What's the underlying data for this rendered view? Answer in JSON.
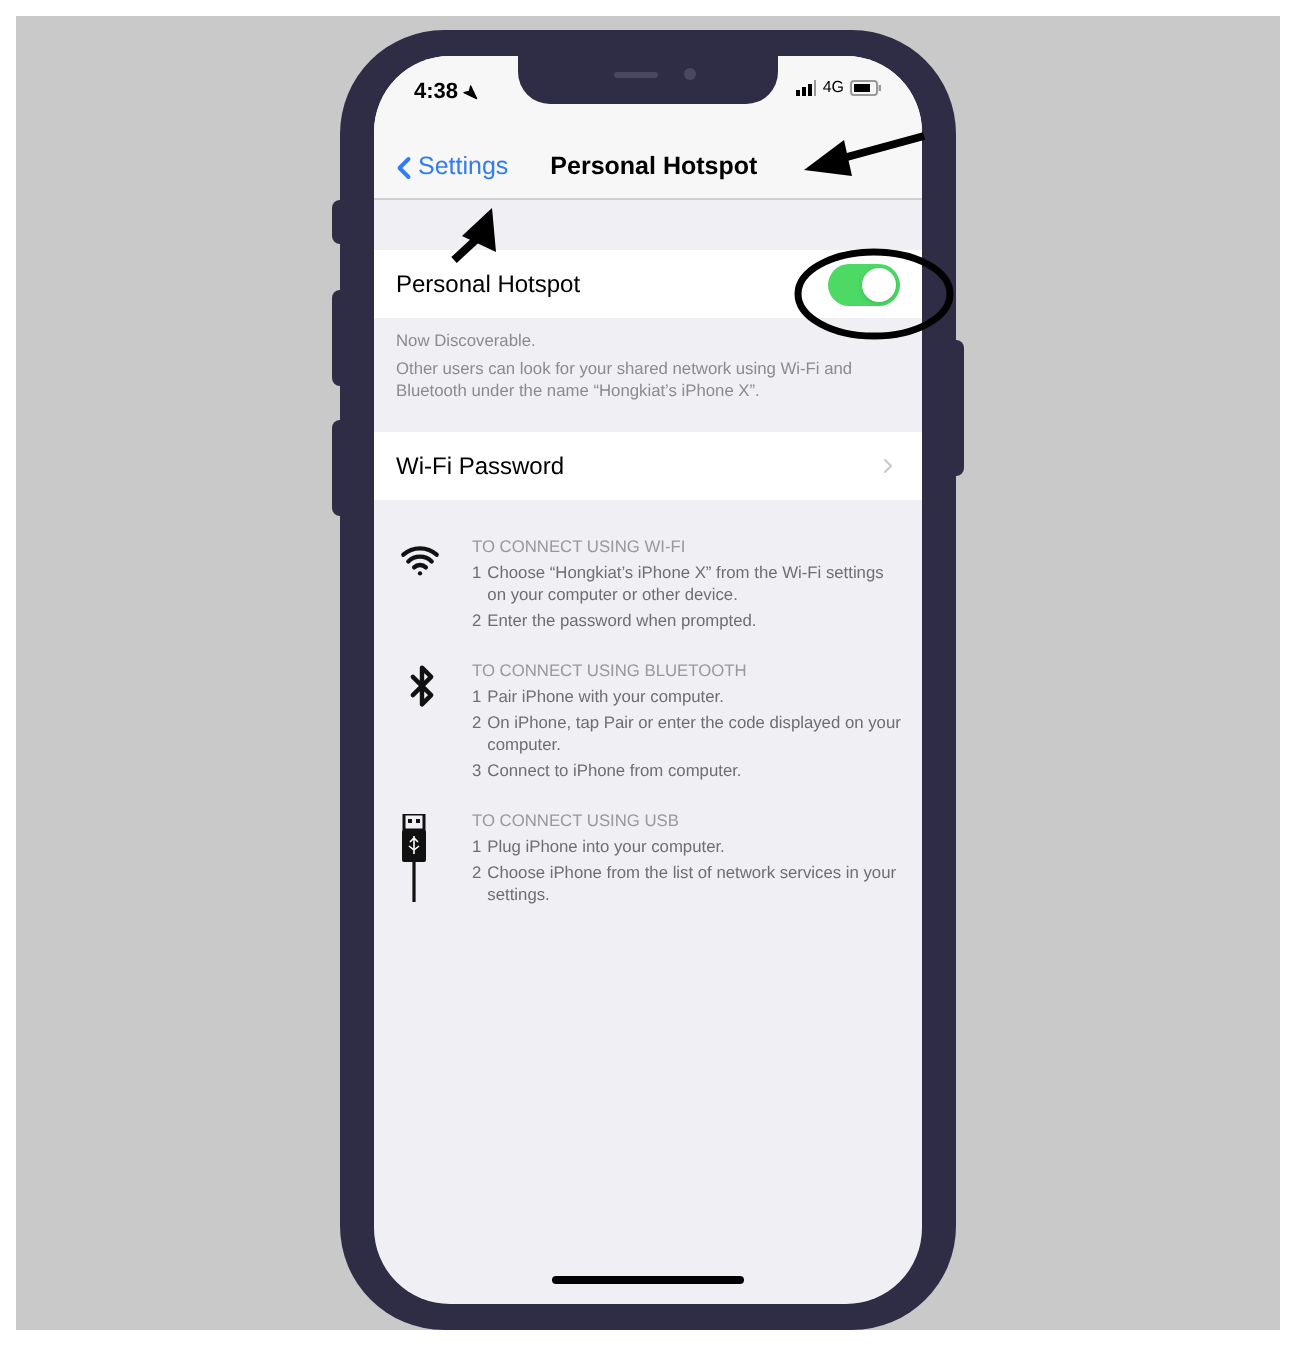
{
  "status_bar": {
    "time": "4:38",
    "network": "4G"
  },
  "nav": {
    "back": "Settings",
    "title": "Personal Hotspot"
  },
  "hotspot": {
    "label": "Personal Hotspot",
    "on": true
  },
  "footer": [
    "Now Discoverable.",
    "Other users can look for your shared network using Wi-Fi and Bluetooth under the name “Hongkiat’s iPhone X”."
  ],
  "password_row": {
    "label": "Wi-Fi Password"
  },
  "sections": [
    {
      "kind": "wifi",
      "heading": "TO CONNECT USING WI-FI",
      "steps": [
        {
          "number": "1",
          "text": "Choose “Hongkiat’s iPhone X” from the Wi-Fi settings on your computer or other device."
        },
        {
          "number": "2",
          "text": "Enter the password when prompted."
        }
      ]
    },
    {
      "kind": "bluetooth",
      "heading": "TO CONNECT USING BLUETOOTH",
      "steps": [
        {
          "number": "1",
          "text": "Pair iPhone with your computer."
        },
        {
          "number": "2",
          "text": "On iPhone, tap Pair or enter the code displayed on your computer."
        },
        {
          "number": "3",
          "text": "Connect to iPhone from computer."
        }
      ]
    },
    {
      "kind": "usb",
      "heading": "TO CONNECT USING USB",
      "steps": [
        {
          "number": "1",
          "text": "Plug iPhone into your computer."
        },
        {
          "number": "2",
          "text": "Choose iPhone from the list of network services in your settings."
        }
      ]
    }
  ]
}
